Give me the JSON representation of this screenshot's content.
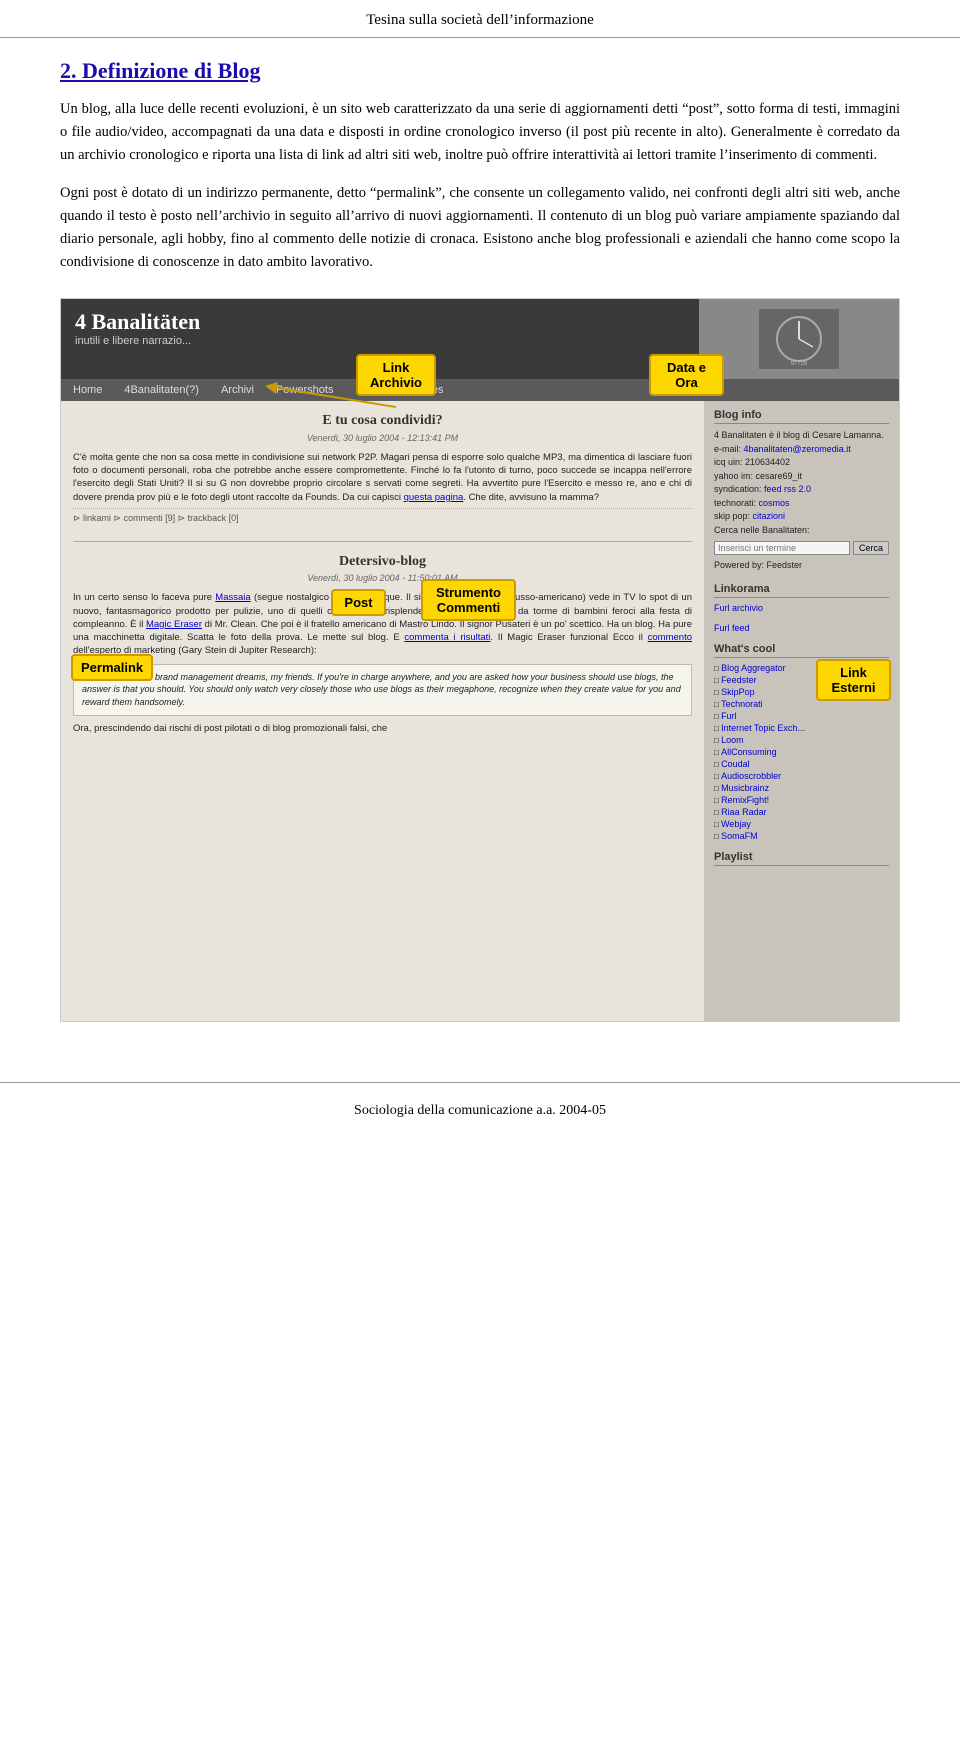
{
  "page": {
    "header_title": "Tesina sulla società dell’informazione",
    "footer_text": "Sociologia della comunicazione a.a. 2004-05"
  },
  "section": {
    "title": "2. Definizione di Blog",
    "paragraph1": "Un blog, alla luce delle recenti evoluzioni, è un sito web caratterizzato da una serie di aggiornamenti detti “post”, sotto forma di testi, immagini o file audio/video, accompagnati da una data e disposti in ordine cronologico inverso (il post più recente in alto). Generalmente è corredato da un archivio cronologico e riporta una lista di link ad altri siti web, inoltre può offrire interattività ai lettori tramite l’inserimento di commenti.",
    "paragraph2": "Ogni post è dotato di un indirizzo permanente, detto “permalink”, che consente un collegamento valido, nei confronti degli altri siti web, anche quando il testo è posto nell’archivio in seguito all’arrivo di nuovi aggiornamenti. Il contenuto di un blog può variare ampiamente spaziando dal diario personale, agli hobby, fino al commento delle notizie di cronaca. Esistono anche blog professionali e aziendali che hanno come scopo la condivisione di conoscenze in dato ambito lavorativo."
  },
  "annotations": {
    "link_archivio": "Link\nArchivio",
    "data_ora": "Data e\nOra",
    "post": "Post",
    "strumento_commenti": "Strumento\nCommenti",
    "permalink": "Permalink",
    "link_esterni": "Link\nEsterni"
  },
  "blog": {
    "title": "4 Banalitäten",
    "subtitle": "inutili e libere narrazio...",
    "nav_items": [
      "Home",
      "4Banalitaten(?)",
      "Archivi",
      "Powershots",
      "RSS for Dummies"
    ],
    "header_right_text": "clock/calendar image",
    "posts": [
      {
        "title": "E tu cosa condividi?",
        "date": "Venerdì, 30 luglio 2004 - 12:13:41 PM",
        "text": "C'è molta gente che non sa cosa mette in condivisione sui network P2P. Magari pensa di esporre solo qualche MP3, ma dimentica di lasciare fuori foto o documenti personali, roba che potrebbe anche essere compromettente. Finché lo fa l'utonto di turno, poco succede se incappa nell'errore l'esercito degli Stati Uniti? Il sito su Google non dovrebbe proprio circolare su servati come segreti. Ha avvertito pure l'Esercito e messo re, ano e chi di dovere prenda prov più e le foto degli utont raccolte da Found s. Da cui capisci questa pagina. Che dite, avvis uno la mamma?",
        "footer": "⊳ linkami ⊳ commenti [9] ⊳ trackback [0]"
      },
      {
        "title": "Detersivo-blog",
        "date": "Venerdì, 30 luglio 2004 - 11:50:01 AM",
        "text": "In un certo senso lo faceva pure Massaia (segue nostalgico saluto). Dunque. Il signor Pusateri (siculo-russo-americano) vede in TV lo spot di un nuovo, fantasmagorico prodotto per pulizie, uno di quelli che ti fanno risplendere la casa insozzata da torme di bambini feroci alla festa di compleanno. È il Magic Eraser di Mr. Clean. Che poi è il fratello americano di Mastro Lindo. Il signor Pusateri è un po' scettico. Ha un blog. Ha pure una macchinetta digitale. Scatta le foto della prova. Le mette sul blog. E commenta i risultati. Il Magic Eraser funzional Ecco il commento dell'esperto di marketing (Gary Stein di Jupiter Research):",
        "quote": "This is the stuff of brand management dreams, my friends. If you're in charge anywhere, and you are asked how your business should use blogs, the answer is that you should. You should only watch very closely those who use blogs as their megaphone, recognize when they create value for you and reward them handsomely.",
        "footer_text": "Ora, prescindendo dai rischi di post pilotati o di blog promozionali falsi, che"
      }
    ],
    "sidebar": {
      "blog_info_title": "Blog info",
      "blog_info_text": "4 Banalitaten è il blog di Cesare Lamanna.\ne-mail: 4banalitaten@zeromedia.it\nicq uin: 210634402\nyahoo im: cesare69_it\nsyndication: feed rss 2.0\ntechnorati: cosmos\nskip pop: citazioni\nCerca nelle Banalitaten:",
      "search_placeholder": "Inserisci un termine",
      "search_button": "Cerca",
      "powered_by": "Powered by: Feedster",
      "linkorama_title": "Linkorama",
      "furl_archivio": "Furl archivio",
      "furl_feed": "Furl feed",
      "whats_cool_title": "What's cool",
      "cool_links": [
        "Blog Aggregator",
        "Feedster",
        "SkipPop",
        "Technorati",
        "Furl",
        "Internet Topic Exch...",
        "Loom",
        "AllConsuming",
        "Coudal",
        "Audioscrobbler",
        "Musicbrainz",
        "RemixFight!",
        "Riaa Radar",
        "Webjay",
        "SomaFM"
      ],
      "playlist_title": "Playlist"
    }
  }
}
